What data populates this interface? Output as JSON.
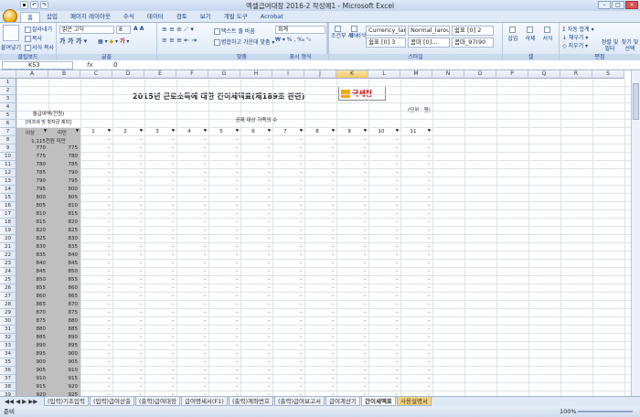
{
  "window": {
    "title": "엑셀급여대장 2016-2 작성예1 - Microsoft Excel"
  },
  "tabs": [
    "홈",
    "삽입",
    "페이지 레이아웃",
    "수식",
    "데이터",
    "검토",
    "보기",
    "개발 도구",
    "Acrobat"
  ],
  "ribbon": {
    "clipboard": {
      "label": "클립보드",
      "paste": "붙여넣기",
      "cut": "잘라내기",
      "copy": "복사",
      "format_painter": "서식 복사"
    },
    "font": {
      "label": "글꼴",
      "name": "맑은 고딕",
      "size": "8"
    },
    "alignment": {
      "label": "맞춤",
      "wrap": "텍스트 줄 바꿈",
      "merge": "병합하고 가운데 맞춤"
    },
    "number": {
      "label": "표시 형식",
      "format": "회계"
    },
    "styles": {
      "label": "스타일",
      "cond": "조건부 서식",
      "table": "표 서식",
      "items": [
        "Currency_lar...",
        "Normal_laroux",
        "쉼표 [0] 2",
        "쉼표 [0] 3",
        "콤마 [0]...",
        "콤마_97(90"
      ]
    },
    "cells": {
      "label": "셀",
      "insert": "삽입",
      "delete": "삭제",
      "format": "서식"
    },
    "editing": {
      "label": "편집",
      "autosum": "자동 합계",
      "fill": "채우기",
      "clear": "지우기",
      "sort": "정렬 및 필터",
      "find": "찾기 및 선택"
    }
  },
  "formula_bar": {
    "name_box": "K53",
    "fx": "fx",
    "value": "0"
  },
  "sheet": {
    "title": "2015년 근로소득에 대한 간이세액표(제189조 관련)",
    "logo": "국세청",
    "unit": "(단위 : 원)",
    "header_pay": "월급여액(천원)",
    "header_pay_sub": "[비과세 및 학자금 제외]",
    "header_family": "공제 대상 가족의 수",
    "col_min": "이상",
    "col_max": "미만",
    "first_row": "1,115천원 미만",
    "dash": "-",
    "family_counts": [
      "1",
      "2",
      "3",
      "4",
      "5",
      "6",
      "7",
      "8",
      "9",
      "10",
      "11"
    ],
    "col_letters": [
      "A",
      "B",
      "C",
      "D",
      "E",
      "F",
      "G",
      "H",
      "I",
      "J",
      "K",
      "L",
      "M",
      "N",
      "O",
      "P",
      "Q",
      "R",
      "S"
    ],
    "selected_col": "K",
    "rows": [
      [
        "770",
        "775"
      ],
      [
        "775",
        "780"
      ],
      [
        "780",
        "785"
      ],
      [
        "785",
        "790"
      ],
      [
        "790",
        "795"
      ],
      [
        "795",
        "800"
      ],
      [
        "800",
        "805"
      ],
      [
        "805",
        "810"
      ],
      [
        "810",
        "815"
      ],
      [
        "815",
        "820"
      ],
      [
        "820",
        "825"
      ],
      [
        "825",
        "830"
      ],
      [
        "830",
        "835"
      ],
      [
        "835",
        "840"
      ],
      [
        "840",
        "845"
      ],
      [
        "845",
        "850"
      ],
      [
        "850",
        "855"
      ],
      [
        "855",
        "860"
      ],
      [
        "860",
        "865"
      ],
      [
        "865",
        "870"
      ],
      [
        "870",
        "875"
      ],
      [
        "875",
        "880"
      ],
      [
        "880",
        "885"
      ],
      [
        "885",
        "890"
      ],
      [
        "890",
        "895"
      ],
      [
        "895",
        "900"
      ],
      [
        "900",
        "905"
      ],
      [
        "905",
        "910"
      ],
      [
        "910",
        "915"
      ],
      [
        "915",
        "920"
      ],
      [
        "920",
        "925"
      ]
    ]
  },
  "sheet_tabs": [
    "(입력)기초입력",
    "(입력)급여산출",
    "(출력)급여대장",
    "급여명세서(F1)",
    "(출력)계좌번호",
    "(출력)급여보고서",
    "급여계산기",
    "간이세액표",
    "사용설명서"
  ],
  "active_sheet": "간이세액표",
  "status": {
    "left": "준비",
    "zoom": "100%"
  }
}
